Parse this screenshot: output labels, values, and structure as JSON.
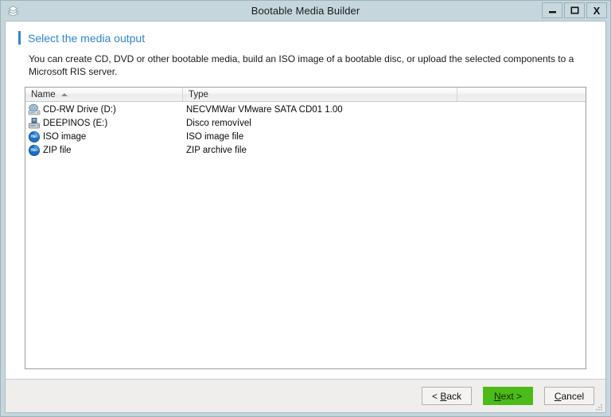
{
  "window": {
    "title": "Bootable Media Builder",
    "app_icon": "diamond-stack-icon",
    "controls": {
      "minimize": "minimize-icon",
      "maximize": "maximize-icon",
      "close": "X"
    }
  },
  "page": {
    "title": "Select the media output",
    "description": "You can create CD, DVD or other bootable media, build an ISO image of a bootable disc, or upload the selected components to a Microsoft RIS server."
  },
  "list": {
    "columns": [
      {
        "label": "Name",
        "sort": "ascending"
      },
      {
        "label": "Type",
        "sort": "none"
      },
      {
        "label": "",
        "sort": "none"
      }
    ],
    "rows": [
      {
        "icon": "cd-drive-icon",
        "name": "CD-RW Drive (D:)",
        "type": "NECVMWar VMware SATA CD01 1.00"
      },
      {
        "icon": "removable-drive-icon",
        "name": "DEEPINOS (E:)",
        "type": "Disco removível"
      },
      {
        "icon": "iso-disc-icon",
        "name": "ISO image",
        "type": "ISO image file"
      },
      {
        "icon": "iso-disc-icon",
        "name": "ZIP file",
        "type": "ZIP archive file"
      }
    ]
  },
  "footer": {
    "back": "< Back",
    "next": "Next >",
    "cancel": "Cancel",
    "next_color": "#4cbb19"
  }
}
